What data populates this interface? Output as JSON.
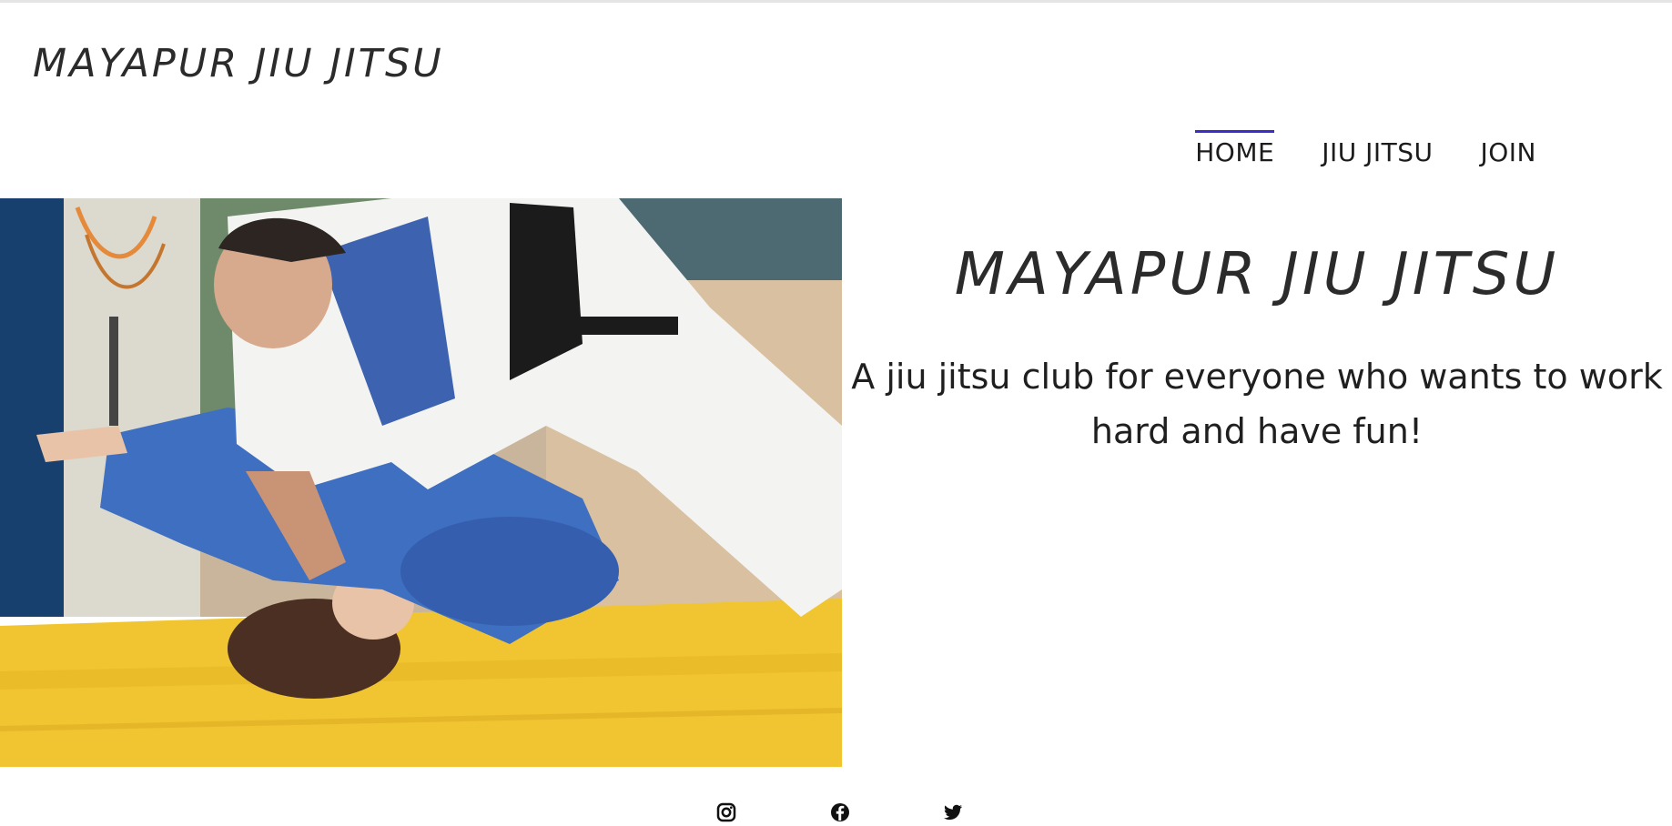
{
  "header": {
    "site_title": "MAYAPUR JIU JITSU"
  },
  "nav": {
    "items": [
      {
        "label": "HOME",
        "active": true
      },
      {
        "label": "JIU JITSU",
        "active": false
      },
      {
        "label": "JOIN",
        "active": false
      }
    ],
    "active_color": "#3b2ec8"
  },
  "hero": {
    "heading": "MAYAPUR JIU JITSU",
    "subheading": "A jiu jitsu club for everyone who wants to work hard and have fun!"
  },
  "social": {
    "icons": [
      "instagram-icon",
      "facebook-icon",
      "twitter-icon"
    ]
  },
  "colors": {
    "mat": "#f0c531",
    "wall": "#17406e",
    "gi_blue": "#3f6fc0",
    "gi_white": "#f3f3f1"
  }
}
